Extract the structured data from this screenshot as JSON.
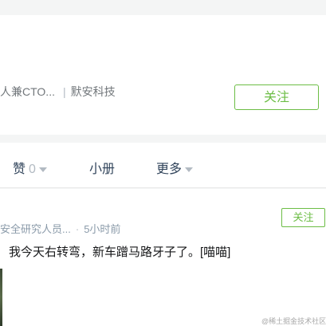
{
  "profile": {
    "title_fragment": "人兼CTO...",
    "company": "默安科技",
    "follow_label": "关注"
  },
  "tabs": {
    "like_label": "赞",
    "like_count": "0",
    "book_label": "小册",
    "more_label": "更多"
  },
  "pin": {
    "author_fragment": "安全研究人员...",
    "time": "5小时前",
    "follow_label": "关注",
    "text": "我今天右转弯，新车蹭马路牙子了。[喵喵]"
  },
  "watermark": "@稀土掘金技术社区"
}
